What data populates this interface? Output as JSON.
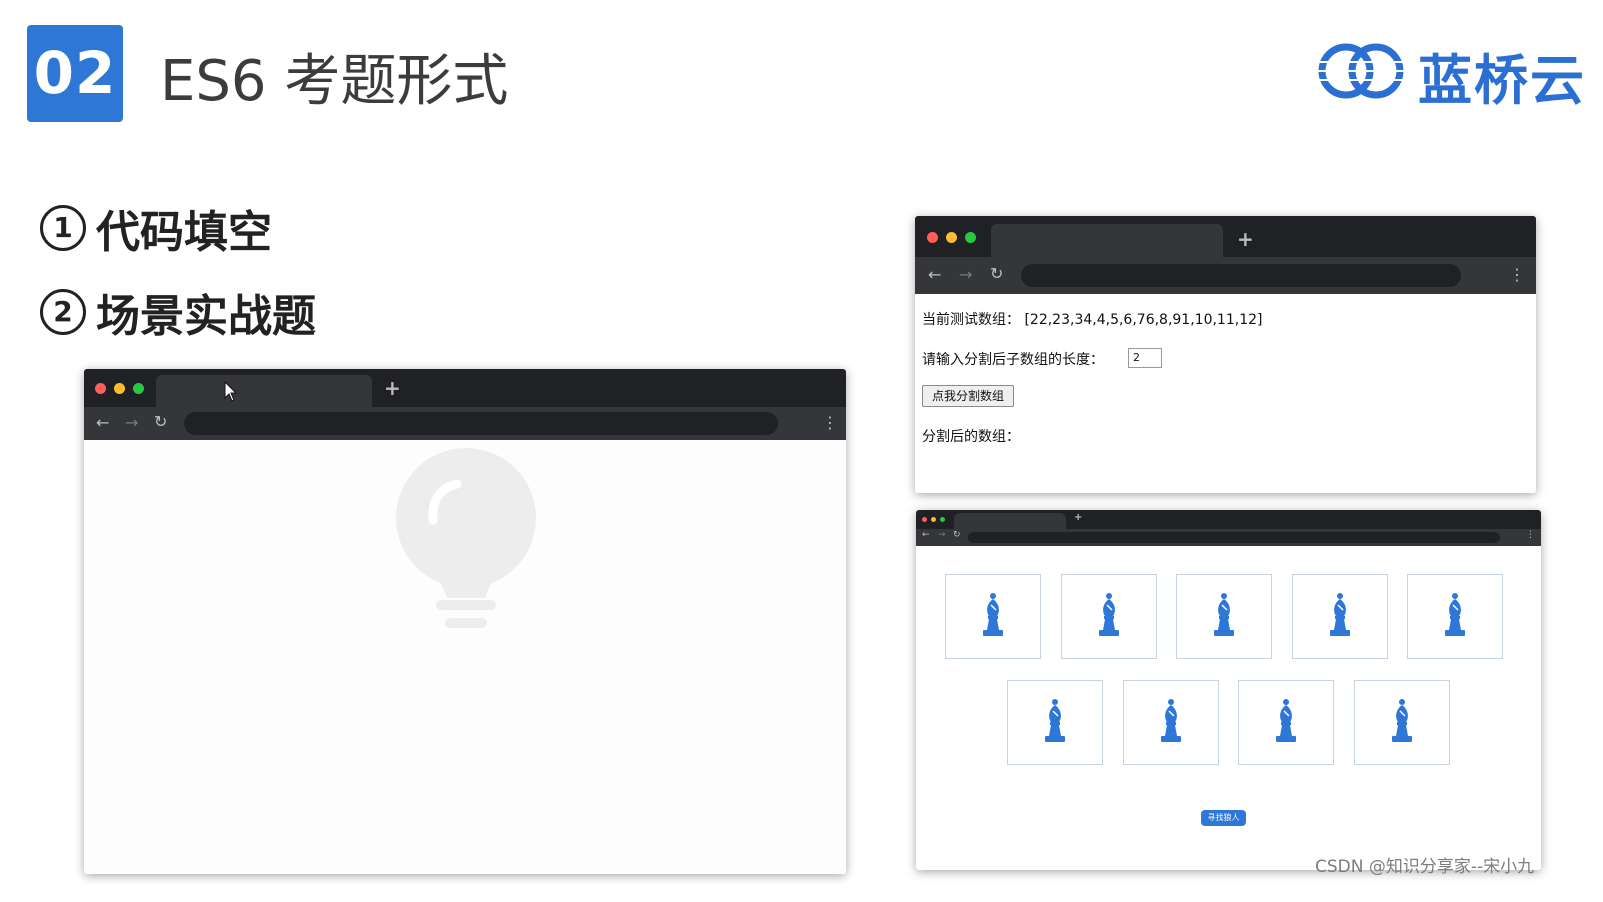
{
  "header": {
    "badge": "02",
    "title": "ES6 考题形式",
    "logo_text": "蓝桥云",
    "brand_color": "#2f77d6"
  },
  "bullets": [
    {
      "number": "1",
      "label": "代码填空"
    },
    {
      "number": "2",
      "label": "场景实战题"
    }
  ],
  "browser_left": {
    "content_icon": "lightbulb-icon",
    "window_controls": [
      "close-dot",
      "minimize-dot",
      "maximize-dot"
    ],
    "dot_colors": [
      "#ff5f57",
      "#febc2e",
      "#28c840"
    ]
  },
  "browser_right_top": {
    "test_array_label": "当前测试数组：",
    "test_array_value": "[22,23,34,4,5,6,76,8,91,10,11,12]",
    "input_label": "请输入分割后子数组的长度：",
    "input_value": "2",
    "button_label": "点我分割数组",
    "result_label": "分割后的数组："
  },
  "browser_right_bottom": {
    "card_icon": "chess-bishop-icon",
    "card_count_row1": 5,
    "card_count_row2": 4,
    "button_label": "寻找狼人",
    "accent_color": "#2f77d6"
  },
  "watermark": "CSDN @知识分享家--宋小九"
}
